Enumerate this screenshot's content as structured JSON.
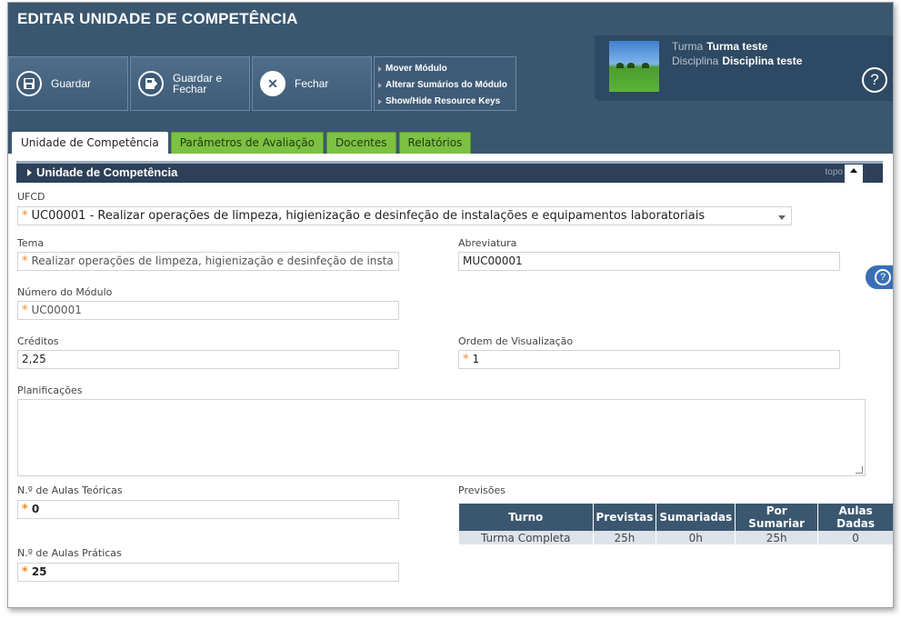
{
  "window": {
    "title": "EDITAR UNIDADE DE COMPETÊNCIA"
  },
  "toolbar": {
    "save_label": "Guardar",
    "save_close_label": "Guardar e Fechar",
    "close_label": "Fechar",
    "more_menu": [
      "Mover Módulo",
      "Alterar Sumários do Módulo",
      "Show/Hide Resource Keys"
    ]
  },
  "context": {
    "turma_label": "Turma",
    "turma_value": "Turma teste",
    "disciplina_label": "Disciplina",
    "disciplina_value": "Disciplina teste",
    "help_glyph": "?"
  },
  "tabs": [
    {
      "label": "Unidade de Competência",
      "active": true
    },
    {
      "label": "Parâmetros de Avaliação",
      "active": false
    },
    {
      "label": "Docentes",
      "active": false
    },
    {
      "label": "Relatórios",
      "active": false
    }
  ],
  "section": {
    "title": "Unidade de Competência",
    "top_label": "topo"
  },
  "form": {
    "ufcd": {
      "label": "UFCD",
      "value": "UC00001 - Realizar operações de limpeza, higienização e desinfeção de instalações e equipamentos laboratoriais",
      "required": true
    },
    "tema": {
      "label": "Tema",
      "value": "Realizar operações de limpeza, higienização e desinfeção de insta",
      "required": true
    },
    "abreviatura": {
      "label": "Abreviatura",
      "value": "MUC00001"
    },
    "numero_modulo": {
      "label": "Número do Módulo",
      "value": "UC00001",
      "required": true
    },
    "creditos": {
      "label": "Créditos",
      "value": "2,25"
    },
    "ordem": {
      "label": "Ordem de Visualização",
      "value": "1",
      "required": true
    },
    "planificacoes": {
      "label": "Planificações",
      "value": ""
    },
    "aulas_teoricas": {
      "label": "N.º de Aulas Teóricas",
      "value": "0",
      "required": true
    },
    "aulas_praticas": {
      "label": "N.º de Aulas Práticas",
      "value": "25",
      "required": true
    },
    "required_marker": "*"
  },
  "previsoes": {
    "label": "Previsões",
    "columns": [
      "Turno",
      "Previstas",
      "Sumariadas",
      "Por Sumariar",
      "Aulas Dadas"
    ],
    "rows": [
      [
        "Turma Completa",
        "25h",
        "0h",
        "25h",
        "0"
      ]
    ]
  },
  "side_help": {
    "glyph": "?"
  },
  "colors": {
    "header": "#3b5770",
    "tab_green": "#7dc142",
    "required": "#f08a24",
    "section_bar": "#2c4058"
  }
}
